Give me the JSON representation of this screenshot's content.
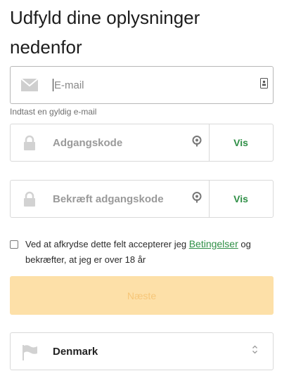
{
  "header": {
    "title": "Udfyld dine oplysninger nedenfor"
  },
  "email": {
    "placeholder": "E-mail",
    "hint": "Indtast en gyldig e-mail",
    "icon": "envelope-icon",
    "trailing_icon": "contact-card-icon"
  },
  "password": {
    "placeholder": "Adgangskode",
    "show_label": "Vis",
    "icon": "lock-icon",
    "trailing_icon": "password-manager-icon"
  },
  "confirm_password": {
    "placeholder": "Bekræft adgangskode",
    "show_label": "Vis",
    "icon": "lock-icon",
    "trailing_icon": "password-manager-icon"
  },
  "terms": {
    "text_before": "Ved at afkrydse dette felt accepterer jeg ",
    "link_label": "Betingelser",
    "text_after": " og bekræfter, at jeg er over 18 år",
    "checked": false
  },
  "next_button": {
    "label": "Næste",
    "enabled": false
  },
  "country": {
    "selected": "Denmark",
    "icon": "flag-icon",
    "trailing_icon": "select-arrows-icon"
  },
  "colors": {
    "accent_green": "#2f8f46",
    "button_disabled_bg": "#fde0a8",
    "button_disabled_text": "#f6c678",
    "border": "#d9d9d9"
  }
}
